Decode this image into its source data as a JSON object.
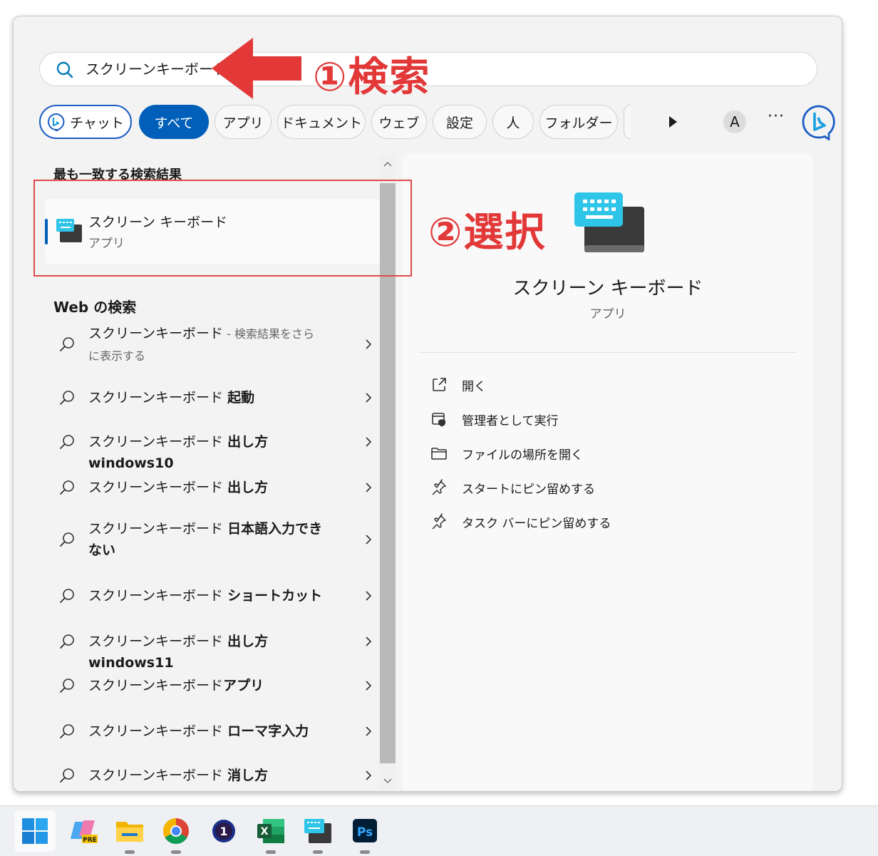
{
  "search": {
    "query": "スクリーンキーボード"
  },
  "annotations": {
    "step1": "①検索",
    "step2": "②選択"
  },
  "filters": [
    {
      "label": "チャット"
    },
    {
      "label": "すべて"
    },
    {
      "label": "アプリ"
    },
    {
      "label": "ドキュメント"
    },
    {
      "label": "ウェブ"
    },
    {
      "label": "設定"
    },
    {
      "label": "人"
    },
    {
      "label": "フォルダー"
    }
  ],
  "account_initial": "A",
  "more_label": "···",
  "best_match": {
    "header": "最も一致する検索結果",
    "title": "スクリーン キーボード",
    "subtitle": "アプリ"
  },
  "web": {
    "header": "Web の検索",
    "results": [
      {
        "main": "スクリーンキーボード",
        "suffix": " - 検索結果をさらに表示する",
        "bold": ""
      },
      {
        "main": "スクリーンキーボード ",
        "bold": "起動"
      },
      {
        "main": "スクリーンキーボード ",
        "bold": "出し方 windows10"
      },
      {
        "main": "スクリーンキーボード ",
        "bold": "出し方"
      },
      {
        "main": "スクリーンキーボード ",
        "bold": "日本語入力できない"
      },
      {
        "main": "スクリーンキーボード ",
        "bold": "ショートカット"
      },
      {
        "main": "スクリーンキーボード ",
        "bold": "出し方 windows11"
      },
      {
        "main": "スクリーンキーボード",
        "bold": "アプリ"
      },
      {
        "main": "スクリーンキーボード ",
        "bold": "ローマ字入力"
      },
      {
        "main": "スクリーンキーボード ",
        "bold": "消し方"
      }
    ]
  },
  "detail": {
    "title": "スクリーン キーボード",
    "subtitle": "アプリ",
    "actions": [
      {
        "label": "開く",
        "icon": "open-icon"
      },
      {
        "label": "管理者として実行",
        "icon": "shield-icon"
      },
      {
        "label": "ファイルの場所を開く",
        "icon": "folder-icon"
      },
      {
        "label": "スタートにピン留めする",
        "icon": "pin-icon"
      },
      {
        "label": "タスク バーにピン留めする",
        "icon": "pin-icon"
      }
    ]
  },
  "taskbar": [
    {
      "name": "start",
      "icon": "windows-icon"
    },
    {
      "name": "copilot",
      "icon": "copilot-pre-icon",
      "badge": "PRE"
    },
    {
      "name": "explorer",
      "icon": "folder-icon"
    },
    {
      "name": "chrome",
      "icon": "chrome-icon"
    },
    {
      "name": "app-1",
      "icon": "app-1-icon",
      "badge": "1"
    },
    {
      "name": "excel",
      "icon": "excel-icon",
      "badge": "X"
    },
    {
      "name": "osk",
      "icon": "keyboard-icon"
    },
    {
      "name": "photoshop",
      "icon": "photoshop-icon",
      "badge": "Ps"
    }
  ],
  "colors": {
    "accent": "#005fb8",
    "annotation": "#e23838",
    "panel": "#f3f3f3"
  }
}
